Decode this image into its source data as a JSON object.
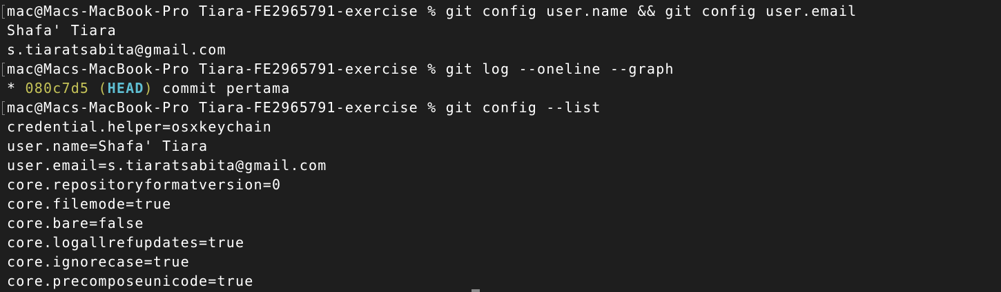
{
  "terminal": {
    "lines": [
      {
        "kind": "prompt",
        "prompt": "mac@Macs-MacBook-Pro Tiara-FE2965791-exercise % ",
        "command": "git config user.name && git config user.email"
      },
      {
        "kind": "output",
        "text": "Shafa' Tiara"
      },
      {
        "kind": "output",
        "text": "s.tiaratsabita@gmail.com"
      },
      {
        "kind": "prompt",
        "prompt": "mac@Macs-MacBook-Pro Tiara-FE2965791-exercise % ",
        "command": "git log --oneline --graph"
      },
      {
        "kind": "log",
        "graph": "* ",
        "hash": "080c7d5",
        "open": " (",
        "ref": "HEAD",
        "close": ")",
        "message": " commit pertama"
      },
      {
        "kind": "prompt",
        "prompt": "mac@Macs-MacBook-Pro Tiara-FE2965791-exercise % ",
        "command": "git config --list"
      },
      {
        "kind": "output",
        "text": "credential.helper=osxkeychain"
      },
      {
        "kind": "output",
        "text": "user.name=Shafa' Tiara"
      },
      {
        "kind": "output",
        "text": "user.email=s.tiaratsabita@gmail.com"
      },
      {
        "kind": "output",
        "text": "core.repositoryformatversion=0"
      },
      {
        "kind": "output",
        "text": "core.filemode=true"
      },
      {
        "kind": "output",
        "text": "core.bare=false"
      },
      {
        "kind": "output",
        "text": "core.logallrefupdates=true"
      },
      {
        "kind": "output",
        "text": "core.ignorecase=true"
      },
      {
        "kind": "output",
        "text": "core.precomposeunicode=true"
      }
    ],
    "colors": {
      "background": "#1e1e1e",
      "foreground": "#ffffff",
      "commit_hash": "#c5c358",
      "head_ref": "#5fbfd3"
    }
  }
}
